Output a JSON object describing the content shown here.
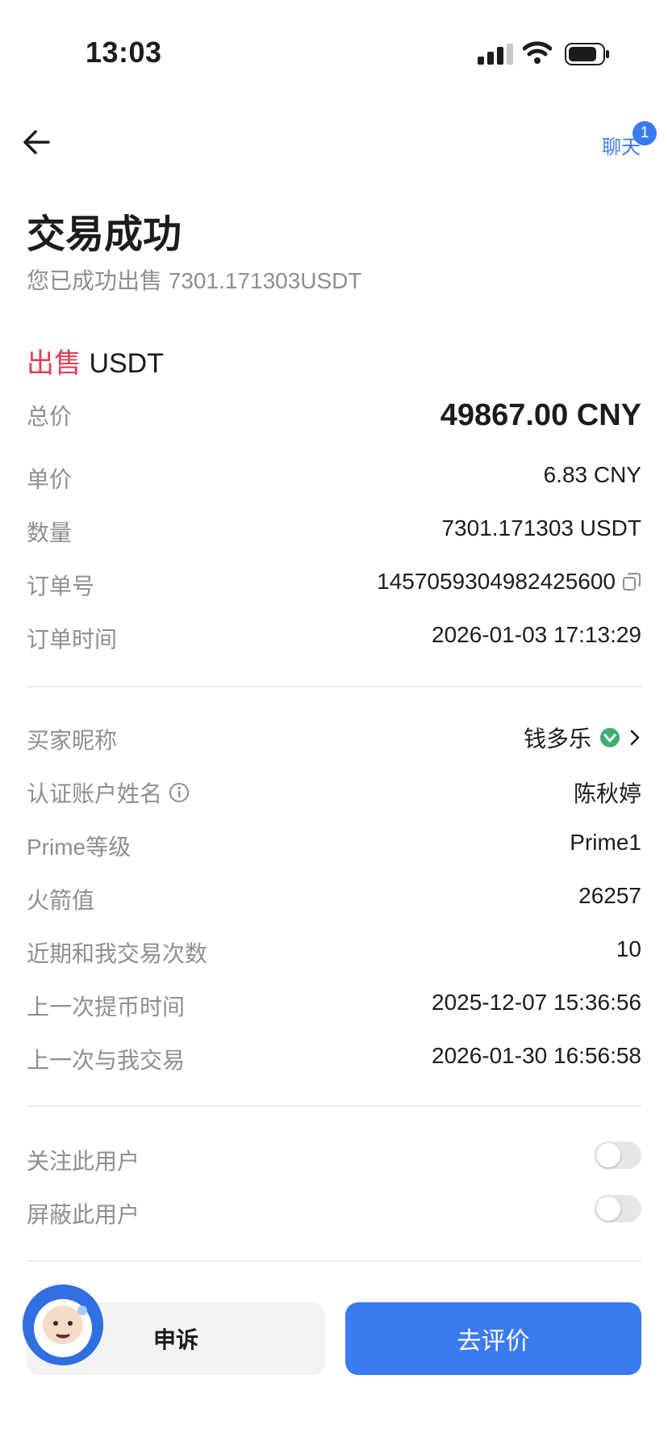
{
  "status_bar": {
    "time": "13:03"
  },
  "nav": {
    "chat_label": "聊天",
    "chat_badge": "1"
  },
  "header": {
    "title": "交易成功",
    "subtitle": "您已成功出售 7301.171303USDT"
  },
  "trade": {
    "side_label": "出售",
    "asset": "USDT",
    "rows": {
      "total": {
        "label": "总价",
        "value": "49867.00 CNY"
      },
      "unit_price": {
        "label": "单价",
        "value": "6.83 CNY"
      },
      "quantity": {
        "label": "数量",
        "value": "7301.171303 USDT"
      },
      "order_no": {
        "label": "订单号",
        "value": "1457059304982425600"
      },
      "order_time": {
        "label": "订单时间",
        "value": "2026-01-03 17:13:29"
      }
    }
  },
  "buyer": {
    "nickname": {
      "label": "买家昵称",
      "value": "钱多乐"
    },
    "verified_name": {
      "label": "认证账户姓名",
      "value": "陈秋婷"
    },
    "prime_level": {
      "label": "Prime等级",
      "value": "Prime1"
    },
    "rocket_value": {
      "label": "火箭值",
      "value": "26257"
    },
    "recent_trades": {
      "label": "近期和我交易次数",
      "value": "10"
    },
    "last_withdraw": {
      "label": "上一次提币时间",
      "value": "2025-12-07 15:36:56"
    },
    "last_trade": {
      "label": "上一次与我交易",
      "value": "2026-01-30 16:56:58"
    }
  },
  "settings": {
    "follow": {
      "label": "关注此用户",
      "on": false
    },
    "block": {
      "label": "屏蔽此用户",
      "on": false
    }
  },
  "actions": {
    "appeal": "申诉",
    "review": "去评价"
  },
  "colors": {
    "accent": "#3a7bf0",
    "sell": "#e03e52",
    "verified": "#3fae72"
  }
}
